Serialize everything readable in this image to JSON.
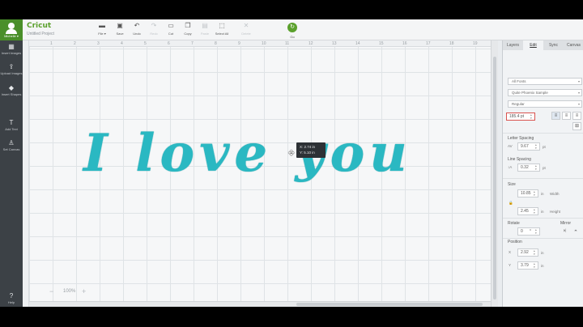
{
  "app": {
    "brand": "Cricut",
    "project_name": "Untitled Project",
    "profile_label": "Michelle ▾"
  },
  "toolbar": [
    {
      "label": "File ▾",
      "icon": "folder-icon",
      "enabled": true
    },
    {
      "label": "Save",
      "icon": "save-icon",
      "enabled": true
    },
    {
      "label": "Undo",
      "icon": "undo-icon",
      "enabled": true
    },
    {
      "label": "Redo",
      "icon": "redo-icon",
      "enabled": false
    },
    {
      "label": "Cut",
      "icon": "cut-icon",
      "enabled": true
    },
    {
      "label": "Copy",
      "icon": "copy-icon",
      "enabled": true
    },
    {
      "label": "Paste",
      "icon": "paste-icon",
      "enabled": false
    },
    {
      "label": "Select All",
      "icon": "select-all-icon",
      "enabled": true
    },
    {
      "label": "Delete",
      "icon": "delete-icon",
      "enabled": false
    }
  ],
  "go_label": "Go",
  "sidebar": [
    {
      "label": "Insert Images",
      "icon": "image-icon"
    },
    {
      "label": "Upload Images",
      "icon": "upload-icon"
    },
    {
      "label": "Insert Shapes",
      "icon": "shapes-icon"
    },
    {
      "label": "Add Text",
      "icon": "text-icon"
    },
    {
      "label": "Set Canvas",
      "icon": "shirt-icon"
    },
    {
      "label": "Help",
      "icon": "help-icon"
    }
  ],
  "canvas": {
    "text": "I love you",
    "ruler_numbers": [
      "1",
      "2",
      "3",
      "4",
      "5",
      "6",
      "7",
      "8",
      "9",
      "10",
      "11",
      "12",
      "13",
      "14",
      "15",
      "16",
      "17",
      "18",
      "19"
    ],
    "tooltip_x": "X: 2.74 in",
    "tooltip_y": "Y: 5.10 in",
    "zoom": "100%",
    "text_color": "#2ab8c2"
  },
  "panel": {
    "tabs": [
      "Layers",
      "Edit",
      "Sync",
      "Canvas"
    ],
    "active_tab": "Edit",
    "font_filter": "All Fonts",
    "font_name": "Quite Phoenix Sample",
    "font_style": "Regular",
    "font_size": "185.4 pt",
    "letter_spacing_label": "Letter Spacing",
    "letter_spacing": "9.67",
    "line_spacing_label": "Line Spacing",
    "line_spacing": "0.32",
    "unit_pt": "pt",
    "size_label": "Size",
    "width": "10.85",
    "width_label": "Width",
    "height": "2.45",
    "height_label": "Height",
    "unit_in": "in",
    "rotate_label": "Rotate",
    "rotate": "0",
    "rotate_unit": "°",
    "mirror_label": "Mirror",
    "position_label": "Position",
    "pos_x_label": "X",
    "pos_x": "2.92",
    "pos_y_label": "Y",
    "pos_y": "3.79"
  }
}
